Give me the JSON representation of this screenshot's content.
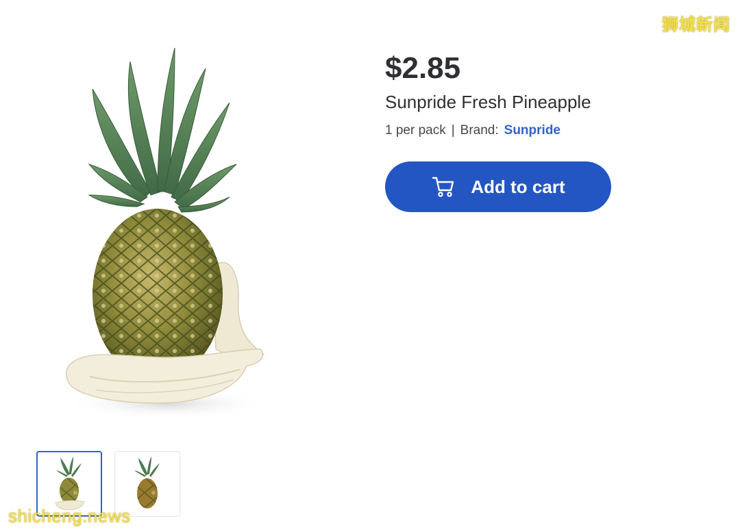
{
  "watermarks": {
    "top_right": "狮城新闻",
    "bottom_left": "shicheng.news"
  },
  "product": {
    "price": "$2.85",
    "title": "Sunpride Fresh Pineapple",
    "pack_info": "1 per pack",
    "separator": "|",
    "brand_label": "Brand:",
    "brand_name": "Sunpride",
    "add_to_cart_label": "Add to cart"
  },
  "images": {
    "main_image": "pineapple-on-cloth-image",
    "thumbnails": [
      {
        "name": "pineapple-on-cloth-thumbnail",
        "selected": true
      },
      {
        "name": "pineapple-plain-thumbnail",
        "selected": false
      }
    ]
  },
  "colors": {
    "accent": "#2456c3",
    "brand_link": "#2e64c5",
    "text": "#2e2f32",
    "watermark": "#f3e04a"
  },
  "icons": {
    "cart": "cart-icon"
  }
}
